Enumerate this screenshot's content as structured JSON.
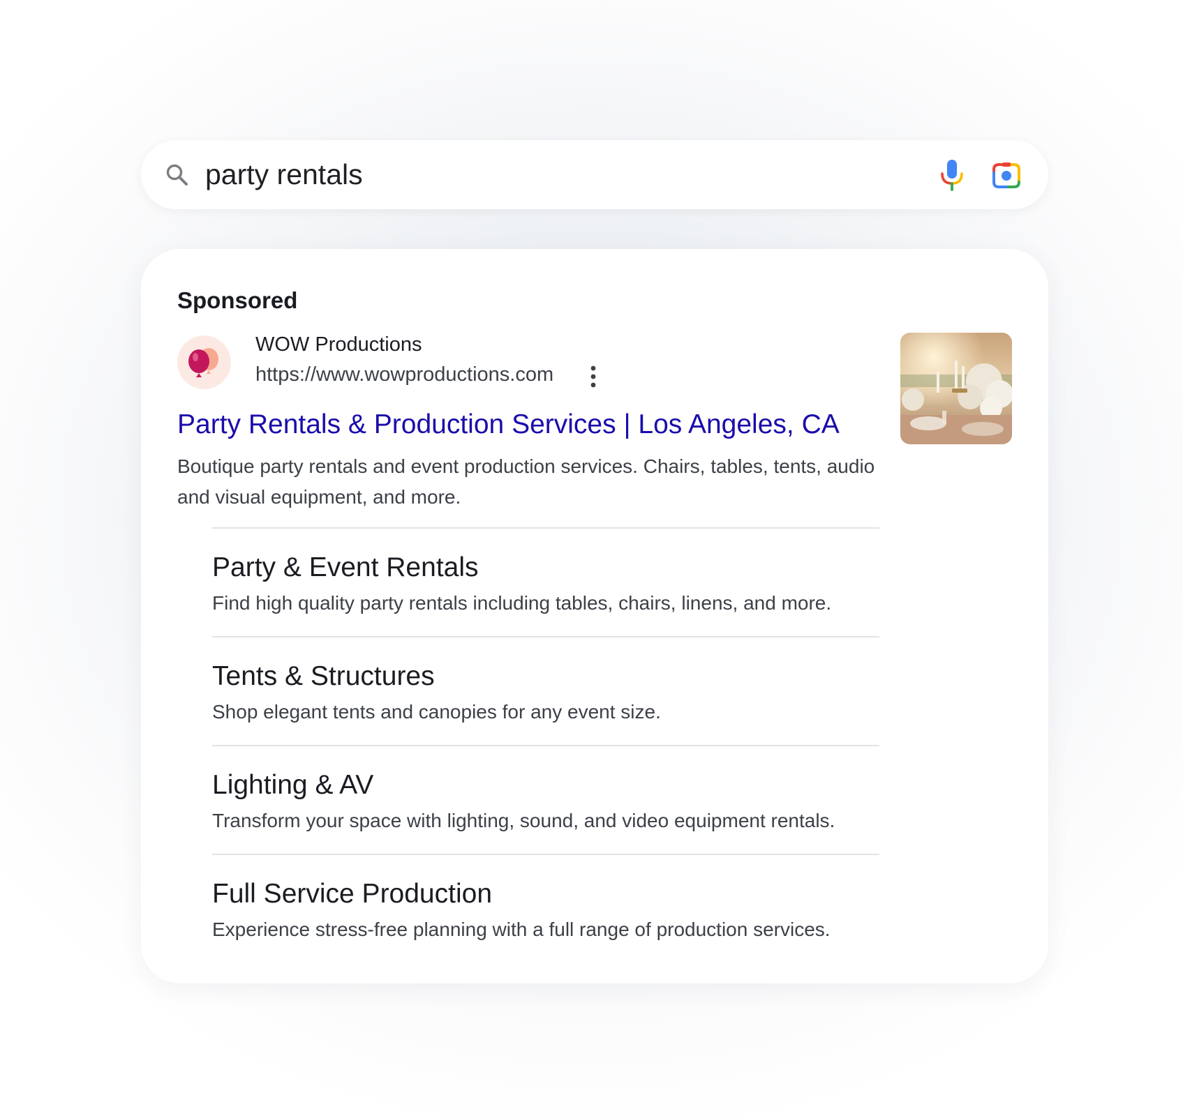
{
  "search": {
    "query": "party rentals"
  },
  "icons": {
    "search": "search-icon",
    "voice": "microphone-icon",
    "image_search": "camera-lens-icon",
    "more": "more-vert-icon",
    "logo": "balloon-icon"
  },
  "colors": {
    "headline_link": "#1a0dab",
    "google_blue": "#4285f4",
    "google_red": "#ea4335",
    "google_yellow": "#fbbc04",
    "google_green": "#34a853",
    "logo_balloon": "#c2185b",
    "logo_background": "#fde9e4"
  },
  "ad": {
    "label": "Sponsored",
    "advertiser": "WOW Productions",
    "url": "https://www.wowproductions.com",
    "headline": "Party Rentals & Production Services | Los Angeles, CA",
    "description": "Boutique party rentals and event production services. Chairs, tables, tents, audio and visual equipment, and more.",
    "sitelinks": [
      {
        "title": "Party & Event Rentals",
        "description": "Find high quality party rentals including tables, chairs, linens, and more."
      },
      {
        "title": "Tents & Structures",
        "description": "Shop elegant tents and canopies for any event size."
      },
      {
        "title": "Lighting & AV",
        "description": "Transform your space with lighting, sound, and video equipment rentals."
      },
      {
        "title": "Full Service Production",
        "description": "Experience stress-free planning with a full range of production services."
      }
    ]
  }
}
